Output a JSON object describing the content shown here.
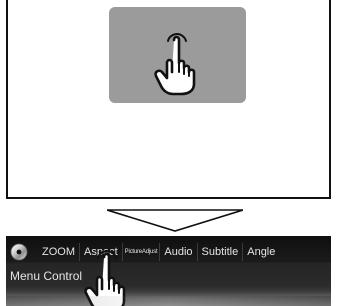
{
  "toolbar": {
    "tabs": [
      {
        "label": "ZOOM"
      },
      {
        "label": "Aspect"
      },
      {
        "label": "PictureAdjust"
      },
      {
        "label": "Audio"
      },
      {
        "label": "Subtitle"
      },
      {
        "label": "Angle"
      }
    ]
  },
  "menu": {
    "label": "Menu Control"
  },
  "icons": {
    "top_touch": "hand-pointer-icon",
    "down_indicator": "down-arrow-icon",
    "disc": "disc-icon",
    "bottom_touch": "hand-pointer-icon"
  },
  "colors": {
    "touch_target": "#9b9b9b",
    "toolbar_bg": "#111111",
    "toolbar_text": "#e4e4e4"
  }
}
